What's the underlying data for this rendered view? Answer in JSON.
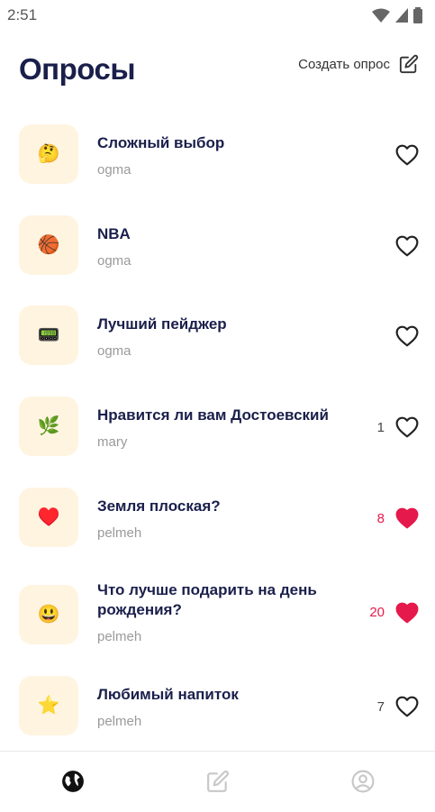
{
  "status": {
    "time": "2:51"
  },
  "header": {
    "title": "Опросы",
    "create_label": "Создать опрос"
  },
  "polls": [
    {
      "title": "Сложный выбор",
      "author": "ogma",
      "icon": "🤔",
      "icon_name": "thinking-face-icon",
      "likes": "",
      "liked": false
    },
    {
      "title": "NBA",
      "author": "ogma",
      "icon": "🏀",
      "icon_name": "basketball-icon",
      "likes": "",
      "liked": false
    },
    {
      "title": "Лучший пейджер",
      "author": "ogma",
      "icon": "📟",
      "icon_name": "pager-icon",
      "likes": "",
      "liked": false
    },
    {
      "title": "Нравится ли вам  Достоевский",
      "author": "mary",
      "icon": "🌿",
      "icon_name": "herb-icon",
      "likes": "1",
      "liked": false
    },
    {
      "title": "Земля плоская?",
      "author": "pelmeh",
      "icon": "♥️",
      "icon_name": "heart-suit-icon",
      "likes": "8",
      "liked": true
    },
    {
      "title": "Что лучше подарить на день рождения?",
      "author": "pelmeh",
      "icon": "😃",
      "icon_name": "smiley-face-icon",
      "likes": "20",
      "liked": true
    },
    {
      "title": "Любимый напиток",
      "author": "pelmeh",
      "icon": "⭐",
      "icon_name": "star-icon",
      "likes": "7",
      "liked": false
    }
  ],
  "nav": [
    {
      "name": "nav-polls",
      "icon": "globe-icon",
      "active": true
    },
    {
      "name": "nav-create",
      "icon": "edit-icon",
      "active": false
    },
    {
      "name": "nav-profile",
      "icon": "profile-icon",
      "active": false
    }
  ],
  "colors": {
    "accent": "#e5194b",
    "title": "#1a1f4b",
    "icon_bg": "#fff4e0",
    "muted": "#9a9a9a"
  }
}
